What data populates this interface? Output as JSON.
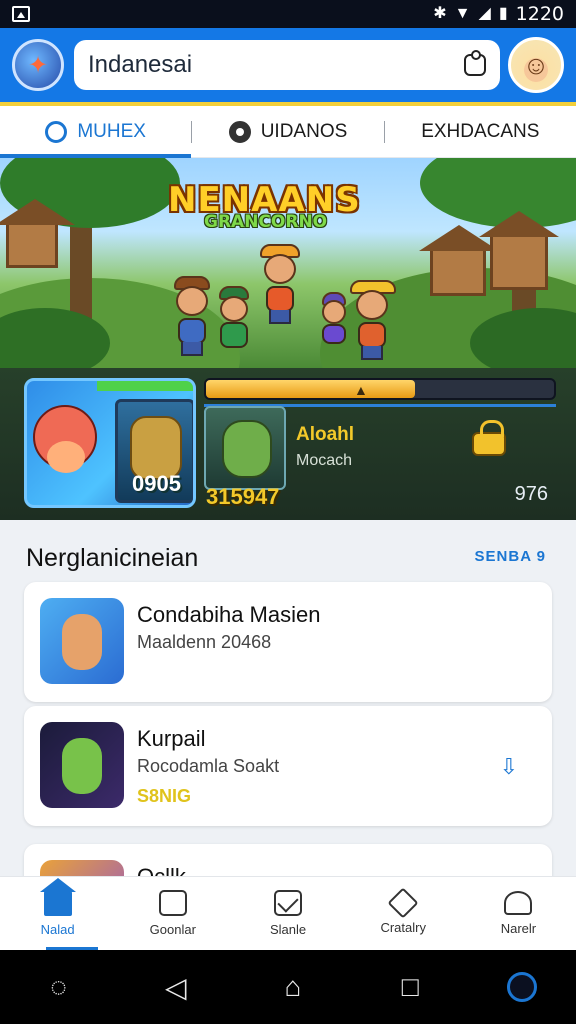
{
  "status_bar": {
    "time": "1220",
    "icons": [
      "app-icon",
      "bluetooth-icon",
      "wifi-icon",
      "signal-icon",
      "battery-icon"
    ]
  },
  "header": {
    "search_value": "Indanesai",
    "logo_icon": "game-logo-icon",
    "avatar_icon": "user-avatar-icon"
  },
  "tabs": [
    {
      "label": "MUHEX",
      "active": true,
      "icon": "map-icon"
    },
    {
      "label": "UIDANOS",
      "active": false,
      "icon": "search-icon"
    },
    {
      "label": "EXHDACANS",
      "active": false
    }
  ],
  "banner": {
    "title": "NENAANS",
    "subtitle": "GRANCORNO"
  },
  "game_row": {
    "big_card_number": "0905",
    "small_card_score": "315947",
    "name": "Aloahl",
    "sub": "Mocach",
    "count": "976",
    "progress": 0.6
  },
  "section": {
    "title": "Nerglanicineian",
    "link": "SENBA 9",
    "items": [
      {
        "title": "Condabiha Masien",
        "subtitle": "Maaldenn 20468"
      },
      {
        "title": "Kurpail",
        "subtitle": "Rocodamla Soakt",
        "tag": "S8NIG",
        "action_icon": "download-icon"
      },
      {
        "title": "Ocllk",
        "subtitle": ""
      }
    ]
  },
  "bottom_nav": [
    {
      "label": "Nalad",
      "icon": "home-icon",
      "active": true
    },
    {
      "label": "Goonlar",
      "icon": "bag-icon",
      "active": false
    },
    {
      "label": "Slanle",
      "icon": "mail-icon",
      "active": false
    },
    {
      "label": "Cratalry",
      "icon": "cube-icon",
      "active": false
    },
    {
      "label": "Narelr",
      "icon": "user-icon",
      "active": false
    }
  ],
  "system_nav": [
    "assist-icon",
    "back-icon",
    "home-icon",
    "recents-icon",
    "assistant-circle-icon"
  ],
  "colors": {
    "primary": "#1478e6",
    "accent": "#f3cf3a",
    "link": "#1b76d2",
    "gold": "#f3c92a"
  }
}
